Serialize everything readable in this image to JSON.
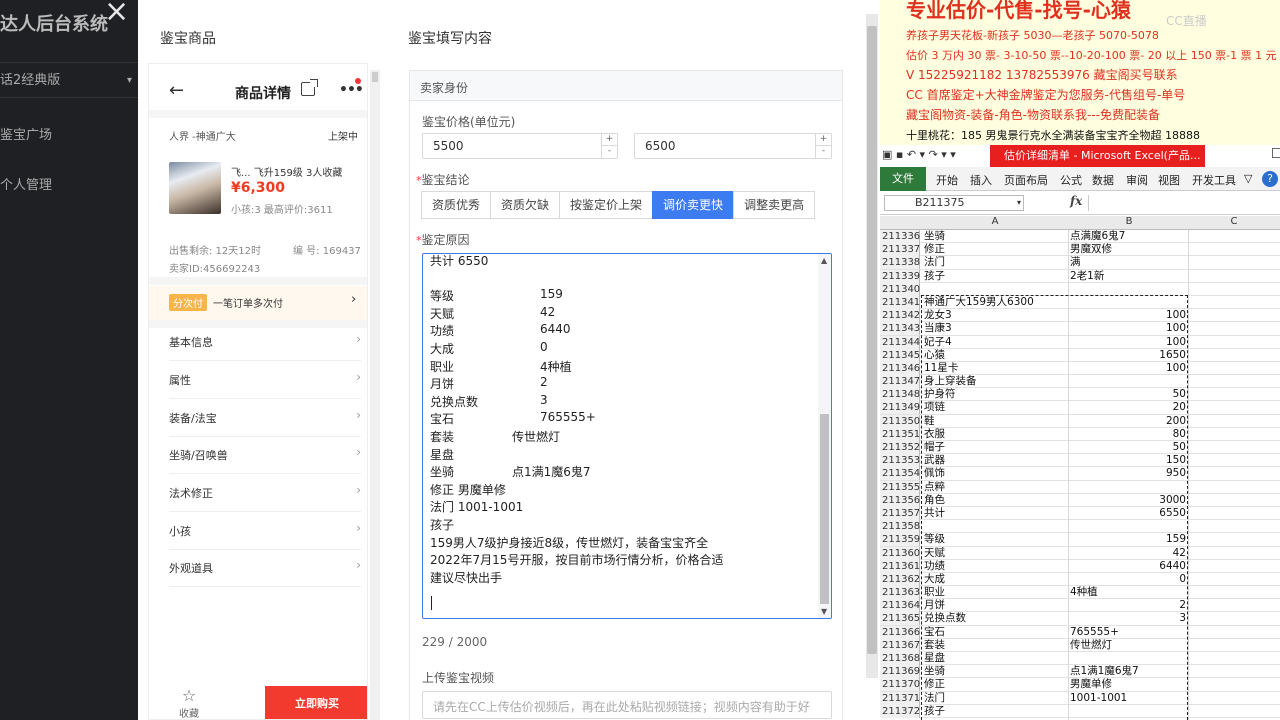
{
  "admin": {
    "brand": "达人后台系统",
    "version": "话2经典版",
    "nav": [
      "鉴宝广场",
      "个人管理"
    ]
  },
  "modal": {
    "left_title": "鉴宝商品",
    "right_title": "鉴宝填写内容"
  },
  "phone": {
    "header_title": "商品详情",
    "server": "人界 -神通广大",
    "status": "上架中",
    "product_name": "飞...    飞升159级  3人收藏",
    "price": "¥6,300",
    "sub": "小孩:3  最高评价:3611",
    "remaining": "出售剩余: 12天12时",
    "serial": "编  号: 169437",
    "seller_id": "卖家ID:456692243",
    "installment_tag": "分次付",
    "installment_text": "一笔订单多次付",
    "menu": [
      "基本信息",
      "属性",
      "装备/法宝",
      "坐骑/召唤兽",
      "法术修正",
      "小孩",
      "外观道具"
    ],
    "favorite": "收藏",
    "buy": "立即购买"
  },
  "form": {
    "section_title": "卖家身份",
    "price_label": "鉴宝价格(单位元)",
    "price_min": "5500",
    "price_max": "6500",
    "conclusion_label": "鉴宝结论",
    "conclusion_options": [
      "资质优秀",
      "资质欠缺",
      "按鉴定价上架",
      "调价卖更快",
      "调整卖更高"
    ],
    "conclusion_selected": "调价卖更快",
    "reason_label": "鉴定原因",
    "reason_lines": [
      {
        "k": "共计 6550",
        "v": ""
      },
      {
        "k": "",
        "v": ""
      },
      {
        "k": "等级",
        "v": "159"
      },
      {
        "k": "天赋",
        "v": "42"
      },
      {
        "k": "功绩",
        "v": "6440"
      },
      {
        "k": "大成",
        "v": "0"
      },
      {
        "k": "职业",
        "v": "4种植"
      },
      {
        "k": "月饼",
        "v": "2"
      },
      {
        "k": "兑换点数",
        "v": "3"
      },
      {
        "k": "宝石",
        "v": "765555+"
      },
      {
        "k": "套装",
        "v2": "传世燃灯"
      },
      {
        "k": "星盘",
        "v": ""
      },
      {
        "k": "坐骑",
        "v2": "点1满1魔6鬼7"
      },
      {
        "k": "修正 男魔单修",
        "v": ""
      },
      {
        "k": "法门 1001-1001",
        "v": ""
      },
      {
        "k": "孩子",
        "v": ""
      },
      {
        "k": "159男人7级护身接近8级，传世燃灯，装备宝宝齐全",
        "v": ""
      },
      {
        "k": "2022年7月15号开服，按目前市场行情分析，价格合适",
        "v": ""
      },
      {
        "k": "建议尽快出手",
        "v": ""
      }
    ],
    "char_count": "229 / 2000",
    "video_label": "上传鉴宝视频",
    "video_placeholder": "请先在CC上传估价视频后，再在此处粘贴视频链接；视频内容有助于好"
  },
  "ad": {
    "title": "专业估价-代售-找号-心猿",
    "lines": [
      "养孩子男天花板-新孩子 5030—老孩子 5070-5078",
      "估价 3 万内 30 票- 3-10-50 票--10-20-100 票- 20 以上 150 票-1 票 1 元",
      "V 15225921182      13782553976    藏宝阁买号联系",
      "CC 首席鉴定+大神金牌鉴定为您服务-代售组号-单号",
      "藏宝阁物资-装备-角色-物资联系我---免费配装备",
      "十里桃花：185 男鬼景行克水全满装备宝宝齐全物超 18888"
    ],
    "logo": "CC直播"
  },
  "excel": {
    "title": "估价详细清单 - Microsoft Excel(产品...",
    "tabs": [
      "文件",
      "开始",
      "插入",
      "页面布局",
      "公式",
      "数据",
      "审阅",
      "视图",
      "开发工具"
    ],
    "name_box": "B211375",
    "fx": "fx",
    "columns": [
      "A",
      "B",
      "C"
    ],
    "rows": [
      {
        "n": "211336",
        "a": "坐骑",
        "b": "点满魔6鬼7"
      },
      {
        "n": "211337",
        "a": "修正",
        "b": "男魔双修"
      },
      {
        "n": "211338",
        "a": "法门",
        "b": "满"
      },
      {
        "n": "211339",
        "a": "孩子",
        "b": "2老1新"
      },
      {
        "n": "211340",
        "a": "",
        "b": ""
      },
      {
        "n": "211341",
        "a": "神通广大159男人6300",
        "b": ""
      },
      {
        "n": "211342",
        "a": "龙女3",
        "b": "100",
        "r": true
      },
      {
        "n": "211343",
        "a": "当康3",
        "b": "100",
        "r": true
      },
      {
        "n": "211344",
        "a": "妃子4",
        "b": "100",
        "r": true
      },
      {
        "n": "211345",
        "a": "心猿",
        "b": "1650",
        "r": true
      },
      {
        "n": "211346",
        "a": "11星卡",
        "b": "100",
        "r": true
      },
      {
        "n": "211347",
        "a": "身上穿装备",
        "b": ""
      },
      {
        "n": "211348",
        "a": "护身符",
        "b": "50",
        "r": true
      },
      {
        "n": "211349",
        "a": "项链",
        "b": "20",
        "r": true
      },
      {
        "n": "211350",
        "a": "鞋",
        "b": "200",
        "r": true
      },
      {
        "n": "211351",
        "a": "衣服",
        "b": "80",
        "r": true
      },
      {
        "n": "211352",
        "a": "帽子",
        "b": "50",
        "r": true
      },
      {
        "n": "211353",
        "a": "武器",
        "b": "150",
        "r": true
      },
      {
        "n": "211354",
        "a": "佩饰",
        "b": "950",
        "r": true
      },
      {
        "n": "211355",
        "a": "点粹",
        "b": ""
      },
      {
        "n": "211356",
        "a": "角色",
        "b": "3000",
        "r": true
      },
      {
        "n": "211357",
        "a": "共计",
        "b": "6550",
        "r": true
      },
      {
        "n": "211358",
        "a": "",
        "b": ""
      },
      {
        "n": "211359",
        "a": "等级",
        "b": "159",
        "r": true
      },
      {
        "n": "211360",
        "a": "天赋",
        "b": "42",
        "r": true
      },
      {
        "n": "211361",
        "a": "功绩",
        "b": "6440",
        "r": true
      },
      {
        "n": "211362",
        "a": "大成",
        "b": "0",
        "r": true
      },
      {
        "n": "211363",
        "a": "职业",
        "b": "4种植"
      },
      {
        "n": "211364",
        "a": "月饼",
        "b": "2",
        "r": true
      },
      {
        "n": "211365",
        "a": "兑换点数",
        "b": "3",
        "r": true
      },
      {
        "n": "211366",
        "a": "宝石",
        "b": "765555+"
      },
      {
        "n": "211367",
        "a": "套装",
        "b": "传世燃灯"
      },
      {
        "n": "211368",
        "a": "星盘",
        "b": ""
      },
      {
        "n": "211369",
        "a": "坐骑",
        "b": "点1满1魔6鬼7"
      },
      {
        "n": "211370",
        "a": "修正",
        "b": "男魔单修"
      },
      {
        "n": "211371",
        "a": "法门",
        "b": "1001-1001"
      },
      {
        "n": "211372",
        "a": "孩子",
        "b": ""
      }
    ]
  },
  "colors": {
    "accent": "#3d7bf0",
    "price_red": "#f03c1e",
    "buy_red": "#f23a2e",
    "excel_green": "#2e7a3a",
    "ad_red": "#e0301e"
  }
}
